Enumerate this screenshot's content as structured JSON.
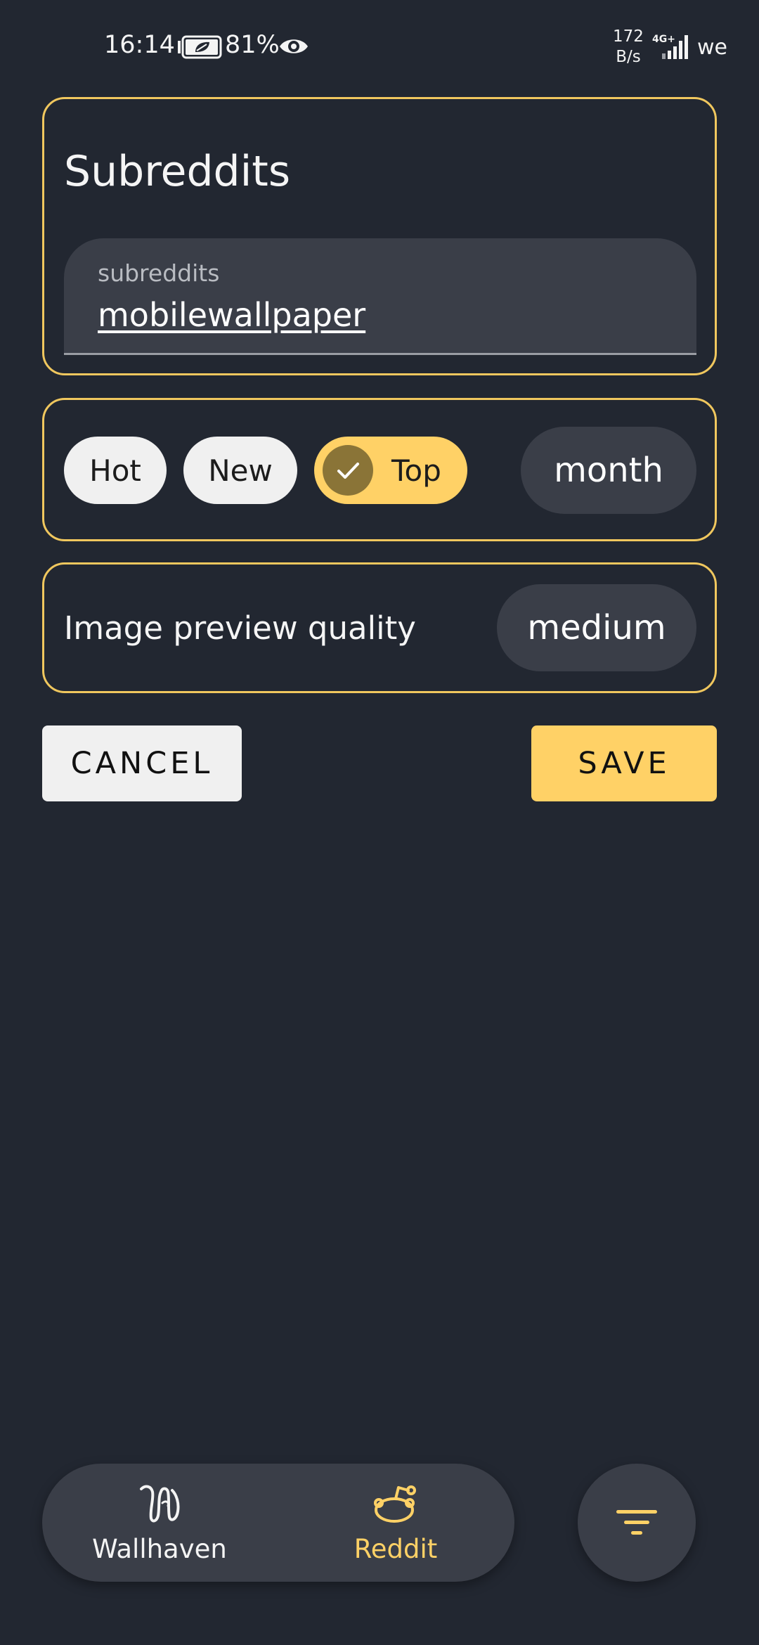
{
  "status_bar": {
    "time": "16:14",
    "battery_percent": "81%",
    "net_speed_value": "172",
    "net_speed_unit": "B/s",
    "network_type": "4G+",
    "carrier": "we"
  },
  "subreddits_card": {
    "title": "Subreddits",
    "input_label": "subreddits",
    "input_value": "mobilewallpaper"
  },
  "sort_card": {
    "chips": [
      {
        "label": "Hot",
        "selected": false
      },
      {
        "label": "New",
        "selected": false
      },
      {
        "label": "Top",
        "selected": true
      }
    ],
    "time_range": "month"
  },
  "quality_card": {
    "label": "Image preview quality",
    "value": "medium"
  },
  "actions": {
    "cancel": "CANCEL",
    "save": "SAVE"
  },
  "bottom_nav": {
    "items": [
      {
        "label": "Wallhaven",
        "icon": "wallhaven-logo-icon",
        "active": false
      },
      {
        "label": "Reddit",
        "icon": "reddit-icon",
        "active": true
      }
    ],
    "fab_icon": "filter-icon"
  },
  "colors": {
    "background": "#222731",
    "accent": "#ffd166",
    "border": "#f0c75e",
    "surface": "#3a3e48"
  }
}
